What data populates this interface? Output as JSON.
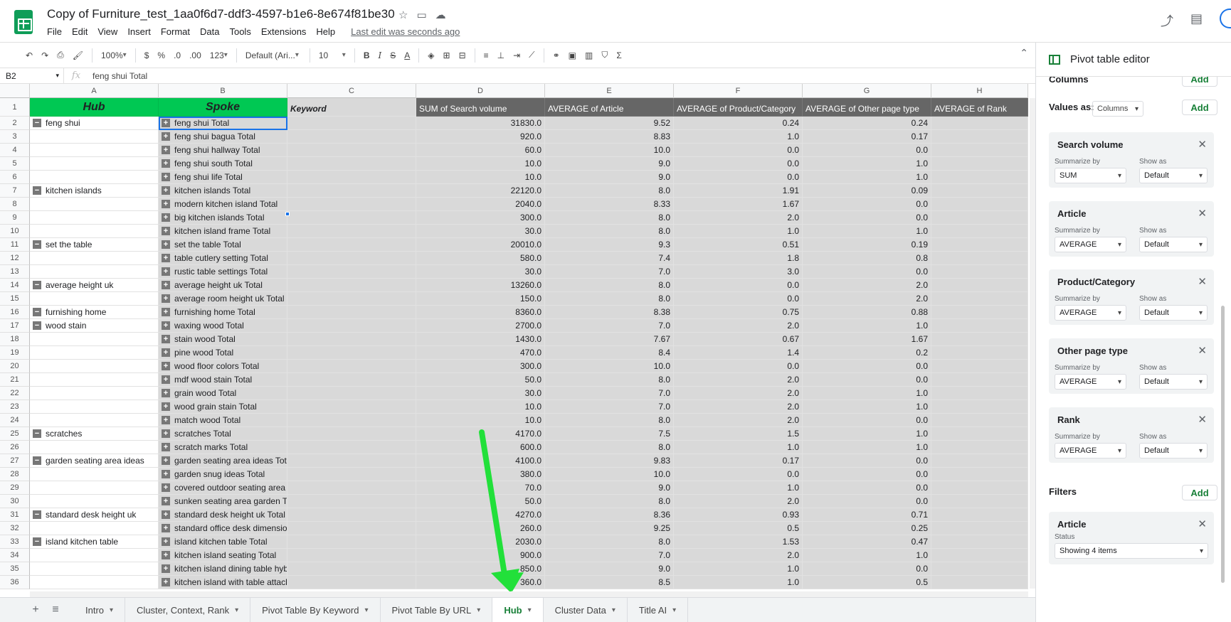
{
  "doc": {
    "title": "Copy of Furniture_test_1aa0f6d7-ddf3-4597-b1e6-8e674f81be30",
    "menu": [
      "File",
      "Edit",
      "View",
      "Insert",
      "Format",
      "Data",
      "Tools",
      "Extensions",
      "Help"
    ],
    "last_edit": "Last edit was seconds ago"
  },
  "toolbar": {
    "zoom": "100%",
    "currency": "$",
    "percent": "%",
    "dec_decrease": ".0",
    "dec_increase": ".00",
    "format_more": "123",
    "font": "Default (Ari...",
    "font_size": "10"
  },
  "formula_bar": {
    "cell_ref": "B2",
    "fx": "fx",
    "content": "feng shui Total"
  },
  "columns": [
    "A",
    "B",
    "C",
    "D",
    "E",
    "F",
    "G",
    "H"
  ],
  "header_row": {
    "num": "1",
    "hub": "Hub",
    "spoke": "Spoke",
    "keyword": "Keyword",
    "d": "SUM of Search volume",
    "e": "AVERAGE of Article",
    "f": "AVERAGE of Product/Category",
    "g": "AVERAGE of Other page type",
    "h": "AVERAGE of Rank"
  },
  "rows": [
    {
      "n": "2",
      "hub": "feng shui",
      "spoke": "feng shui Total",
      "d": "31830.0",
      "e": "9.52",
      "f": "0.24",
      "g": "0.24"
    },
    {
      "n": "3",
      "hub": "",
      "spoke": "feng shui bagua Total",
      "d": "920.0",
      "e": "8.83",
      "f": "1.0",
      "g": "0.17"
    },
    {
      "n": "4",
      "hub": "",
      "spoke": "feng shui hallway Total",
      "d": "60.0",
      "e": "10.0",
      "f": "0.0",
      "g": "0.0"
    },
    {
      "n": "5",
      "hub": "",
      "spoke": "feng shui south Total",
      "d": "10.0",
      "e": "9.0",
      "f": "0.0",
      "g": "1.0"
    },
    {
      "n": "6",
      "hub": "",
      "spoke": "feng shui life Total",
      "d": "10.0",
      "e": "9.0",
      "f": "0.0",
      "g": "1.0"
    },
    {
      "n": "7",
      "hub": "kitchen islands",
      "spoke": "kitchen islands Total",
      "d": "22120.0",
      "e": "8.0",
      "f": "1.91",
      "g": "0.09"
    },
    {
      "n": "8",
      "hub": "",
      "spoke": "modern kitchen island Total",
      "d": "2040.0",
      "e": "8.33",
      "f": "1.67",
      "g": "0.0"
    },
    {
      "n": "9",
      "hub": "",
      "spoke": "big kitchen islands Total",
      "d": "300.0",
      "e": "8.0",
      "f": "2.0",
      "g": "0.0"
    },
    {
      "n": "10",
      "hub": "",
      "spoke": "kitchen island frame Total",
      "d": "30.0",
      "e": "8.0",
      "f": "1.0",
      "g": "1.0"
    },
    {
      "n": "11",
      "hub": "set the table",
      "spoke": "set the table Total",
      "d": "20010.0",
      "e": "9.3",
      "f": "0.51",
      "g": "0.19"
    },
    {
      "n": "12",
      "hub": "",
      "spoke": "table cutlery setting Total",
      "d": "580.0",
      "e": "7.4",
      "f": "1.8",
      "g": "0.8"
    },
    {
      "n": "13",
      "hub": "",
      "spoke": "rustic table settings Total",
      "d": "30.0",
      "e": "7.0",
      "f": "3.0",
      "g": "0.0"
    },
    {
      "n": "14",
      "hub": "average height uk",
      "spoke": "average height uk Total",
      "d": "13260.0",
      "e": "8.0",
      "f": "0.0",
      "g": "2.0"
    },
    {
      "n": "15",
      "hub": "",
      "spoke": "average room height uk Total",
      "d": "150.0",
      "e": "8.0",
      "f": "0.0",
      "g": "2.0"
    },
    {
      "n": "16",
      "hub": "furnishing home",
      "spoke": "furnishing home Total",
      "d": "8360.0",
      "e": "8.38",
      "f": "0.75",
      "g": "0.88"
    },
    {
      "n": "17",
      "hub": "wood stain",
      "spoke": "waxing wood Total",
      "d": "2700.0",
      "e": "7.0",
      "f": "2.0",
      "g": "1.0"
    },
    {
      "n": "18",
      "hub": "",
      "spoke": "stain wood Total",
      "d": "1430.0",
      "e": "7.67",
      "f": "0.67",
      "g": "1.67"
    },
    {
      "n": "19",
      "hub": "",
      "spoke": "pine wood Total",
      "d": "470.0",
      "e": "8.4",
      "f": "1.4",
      "g": "0.2"
    },
    {
      "n": "20",
      "hub": "",
      "spoke": "wood floor colors Total",
      "d": "300.0",
      "e": "10.0",
      "f": "0.0",
      "g": "0.0"
    },
    {
      "n": "21",
      "hub": "",
      "spoke": "mdf wood stain Total",
      "d": "50.0",
      "e": "8.0",
      "f": "2.0",
      "g": "0.0"
    },
    {
      "n": "22",
      "hub": "",
      "spoke": "grain wood Total",
      "d": "30.0",
      "e": "7.0",
      "f": "2.0",
      "g": "1.0"
    },
    {
      "n": "23",
      "hub": "",
      "spoke": "wood grain stain Total",
      "d": "10.0",
      "e": "7.0",
      "f": "2.0",
      "g": "1.0"
    },
    {
      "n": "24",
      "hub": "",
      "spoke": "match wood Total",
      "d": "10.0",
      "e": "8.0",
      "f": "2.0",
      "g": "0.0"
    },
    {
      "n": "25",
      "hub": "scratches",
      "spoke": "scratches Total",
      "d": "4170.0",
      "e": "7.5",
      "f": "1.5",
      "g": "1.0"
    },
    {
      "n": "26",
      "hub": "",
      "spoke": "scratch marks Total",
      "d": "600.0",
      "e": "8.0",
      "f": "1.0",
      "g": "1.0"
    },
    {
      "n": "27",
      "hub": "garden seating area ideas",
      "spoke": "garden seating area ideas Total",
      "d": "4100.0",
      "e": "9.83",
      "f": "0.17",
      "g": "0.0"
    },
    {
      "n": "28",
      "hub": "",
      "spoke": "garden snug ideas Total",
      "d": "380.0",
      "e": "10.0",
      "f": "0.0",
      "g": "0.0"
    },
    {
      "n": "29",
      "hub": "",
      "spoke": "covered outdoor seating area ideas Total",
      "d": "70.0",
      "e": "9.0",
      "f": "1.0",
      "g": "0.0"
    },
    {
      "n": "30",
      "hub": "",
      "spoke": "sunken seating area garden Total",
      "d": "50.0",
      "e": "8.0",
      "f": "2.0",
      "g": "0.0"
    },
    {
      "n": "31",
      "hub": "standard desk height uk",
      "spoke": "standard desk height uk Total",
      "d": "4270.0",
      "e": "8.36",
      "f": "0.93",
      "g": "0.71"
    },
    {
      "n": "32",
      "hub": "",
      "spoke": "standard office desk dimensions Total",
      "d": "260.0",
      "e": "9.25",
      "f": "0.5",
      "g": "0.25"
    },
    {
      "n": "33",
      "hub": "island kitchen table",
      "spoke": "island kitchen table Total",
      "d": "2030.0",
      "e": "8.0",
      "f": "1.53",
      "g": "0.47"
    },
    {
      "n": "34",
      "hub": "",
      "spoke": "kitchen island seating Total",
      "d": "900.0",
      "e": "7.0",
      "f": "2.0",
      "g": "1.0"
    },
    {
      "n": "35",
      "hub": "",
      "spoke": "kitchen island dining table hybrid Total",
      "d": "850.0",
      "e": "9.0",
      "f": "1.0",
      "g": "0.0"
    },
    {
      "n": "36",
      "hub": "",
      "spoke": "kitchen island with table attached Total",
      "d": "360.0",
      "e": "8.5",
      "f": "1.0",
      "g": "0.5"
    }
  ],
  "sheet_tabs": [
    "Intro",
    "Cluster, Context, Rank",
    "Pivot Table By Keyword",
    "Pivot Table By URL",
    "Hub",
    "Cluster Data",
    "Title AI"
  ],
  "active_tab": "Hub",
  "pivot": {
    "title": "Pivot table editor",
    "columns_label": "Columns",
    "values_as_label": "Values as:",
    "values_as_value": "Columns",
    "add_label": "Add",
    "summarize_by_label": "Summarize by",
    "show_as_label": "Show as",
    "cards": [
      {
        "title": "Search volume",
        "summarize": "SUM",
        "show": "Default"
      },
      {
        "title": "Article",
        "summarize": "AVERAGE",
        "show": "Default"
      },
      {
        "title": "Product/Category",
        "summarize": "AVERAGE",
        "show": "Default"
      },
      {
        "title": "Other page type",
        "summarize": "AVERAGE",
        "show": "Default"
      },
      {
        "title": "Rank",
        "summarize": "AVERAGE",
        "show": "Default"
      }
    ],
    "filters_label": "Filters",
    "filter": {
      "title": "Article",
      "status_label": "Status",
      "status_value": "Showing 4 items"
    }
  },
  "colors": {
    "accent_green": "#00c853",
    "header_dark": "#666666",
    "annotation_arrow": "#22e03a",
    "selection": "#1a73e8"
  }
}
